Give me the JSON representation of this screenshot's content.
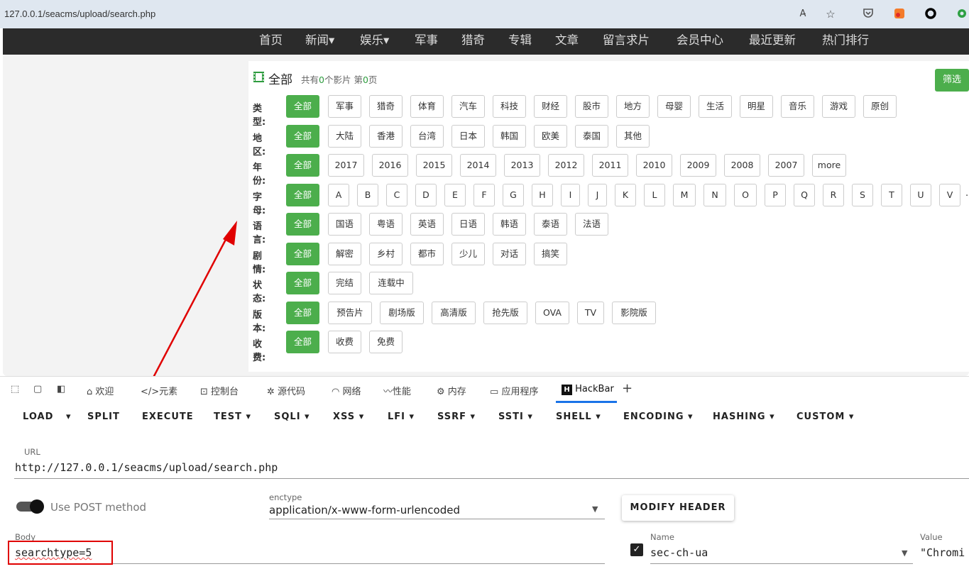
{
  "browser": {
    "url": "127.0.0.1/seacms/upload/search.php",
    "read_aloud_label": "A̵"
  },
  "site_nav": [
    "首页",
    "新闻▾",
    "娱乐▾",
    "军事",
    "猎奇",
    "专辑",
    "文章",
    "留言求片",
    "会员中心",
    "最近更新",
    "热门排行"
  ],
  "panel": {
    "title": "全部",
    "summary_prefix": "共有",
    "count": "0",
    "summary_mid": "个影片 第",
    "page": "0",
    "summary_suffix": "页",
    "filter_button": "筛选"
  },
  "filters": [
    {
      "label": "类型:",
      "all": "全部",
      "tags": [
        "军事",
        "猎奇",
        "体育",
        "汽车",
        "科技",
        "财经",
        "股市",
        "地方",
        "母婴",
        "生活",
        "明星",
        "音乐",
        "游戏",
        "原创"
      ]
    },
    {
      "label": "地区:",
      "all": "全部",
      "tags": [
        "大陆",
        "香港",
        "台湾",
        "日本",
        "韩国",
        "欧美",
        "泰国",
        "其他"
      ]
    },
    {
      "label": "年份:",
      "all": "全部",
      "tags": [
        "2017",
        "2016",
        "2015",
        "2014",
        "2013",
        "2012",
        "2011",
        "2010",
        "2009",
        "2008",
        "2007",
        "more"
      ]
    },
    {
      "label": "字母:",
      "all": "全部",
      "tags": [
        "A",
        "B",
        "C",
        "D",
        "E",
        "F",
        "G",
        "H",
        "I",
        "J",
        "K",
        "L",
        "M",
        "N",
        "O",
        "P",
        "Q",
        "R",
        "S",
        "T",
        "U",
        "V"
      ],
      "more": "..."
    },
    {
      "label": "语言:",
      "all": "全部",
      "tags": [
        "国语",
        "粤语",
        "英语",
        "日语",
        "韩语",
        "泰语",
        "法语"
      ]
    },
    {
      "label": "剧情:",
      "all": "全部",
      "tags": [
        "解密",
        "乡村",
        "都市",
        "少儿",
        "对话",
        "搞笑"
      ]
    },
    {
      "label": "状态:",
      "all": "全部",
      "tags": [
        "完结",
        "连载中"
      ]
    },
    {
      "label": "版本:",
      "all": "全部",
      "tags": [
        "预告片",
        "剧场版",
        "高清版",
        "抢先版",
        "OVA",
        "TV",
        "影院版"
      ]
    },
    {
      "label": "收费:",
      "all": "全部",
      "tags": [
        "收费",
        "免费"
      ]
    }
  ],
  "devtools_tabs": [
    "欢迎",
    "元素",
    "控制台",
    "源代码",
    "网络",
    "性能",
    "内存",
    "应用程序",
    "HackBar"
  ],
  "devtools_add": "+",
  "hackbar": {
    "menu": [
      "LOAD",
      "SPLIT",
      "EXECUTE",
      "TEST ▾",
      "SQLI ▾",
      "XSS ▾",
      "LFI ▾",
      "SSRF ▾",
      "SSTI ▾",
      "SHELL ▾",
      "ENCODING ▾",
      "HASHING ▾",
      "CUSTOM ▾"
    ],
    "load_arrow": "▾",
    "url_label": "URL",
    "url_value": "http://127.0.0.1/seacms/upload/search.php",
    "post_label": "Use POST method",
    "enctype_label": "enctype",
    "enctype_value": "application/x-www-form-urlencoded",
    "modify_header": "MODIFY HEADER",
    "body_label": "Body",
    "body_value": "searchtype=5",
    "header_name_label": "Name",
    "header_name_value": "sec-ch-ua",
    "header_value_label": "Value",
    "header_value_value": "\"Chromi"
  },
  "colors": {
    "green": "#4cae4c",
    "nav_bg": "#2b2b2b",
    "annotation_red": "#e00000"
  }
}
